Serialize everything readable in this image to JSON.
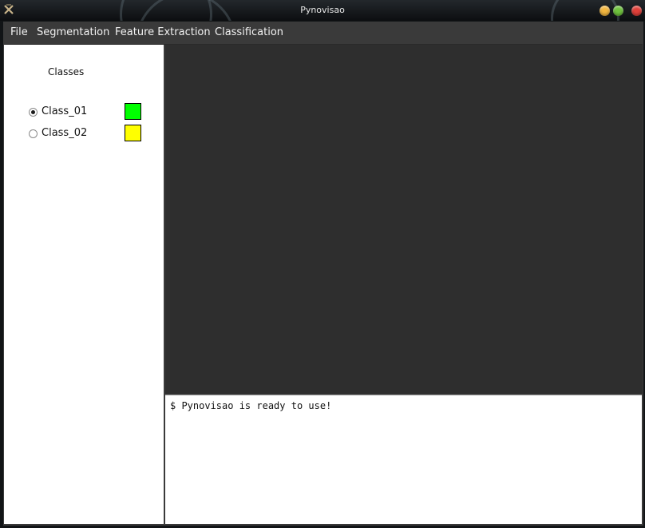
{
  "window": {
    "title": "Pynovisao",
    "icon": "app-logo-icon",
    "controls": [
      "minimize-icon",
      "maximize-icon",
      "close-icon"
    ]
  },
  "menubar": {
    "items": [
      "File",
      "Segmentation",
      "Feature Extraction",
      "Classification"
    ]
  },
  "sidebar": {
    "title": "Classes",
    "classes": [
      {
        "label": "Class_01",
        "selected": true,
        "color": "#00ff00"
      },
      {
        "label": "Class_02",
        "selected": false,
        "color": "#ffff00"
      }
    ]
  },
  "console": {
    "line": "$ Pynovisao is ready to use!"
  },
  "colors": {
    "viewer_background": "#2e2e2e",
    "menubar_background": "#3a3a3a"
  }
}
